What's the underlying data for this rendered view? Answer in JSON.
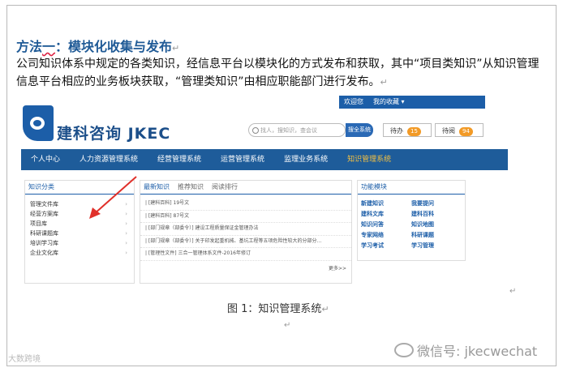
{
  "doc": {
    "heading_prefix": "方法",
    "heading_underlined": "一",
    "heading_rest": "：模块化收集与发布",
    "paragraph": "公司知识体系中规定的各类知识，经信息平台以模块化的方式发布和获取，其中“项目类知识”从知识管理信息平台相应的业务板块获取，“管理类知识”由相应职能部门进行发布。",
    "mark": "↵",
    "caption": "图 1：知识管理系统"
  },
  "screenshot": {
    "logo_text": "建科咨询 JKEC",
    "welcome": [
      "欢迎您",
      "",
      "我的收藏 ▾"
    ],
    "search_placeholder": "找人，搜知识，查会议",
    "search_button": "搜全系统",
    "todo": {
      "label": "待办",
      "count": "15"
    },
    "pending": {
      "label": "待阅",
      "count": "94"
    },
    "nav": [
      "个人中心",
      "人力资源管理系统",
      "经营管理系统",
      "运营管理系统",
      "监理业务系统",
      "知识管理系统"
    ],
    "nav_active_index": 5,
    "category_title": "知识分类",
    "categories": [
      "管理文件库",
      "经营方案库",
      "项目库",
      "科研课题库",
      "培训学习库",
      "企业文化库"
    ],
    "news_tabs": [
      "最新知识",
      "推荐知识",
      "阅读排行"
    ],
    "news": [
      "| [建科百科] 19号文",
      "| [建科百科] 87号文",
      "| [部门规章（部委令）] 建设工程质量保证金管理办法",
      "| [部门规章（部委令）] 关于印发起重机械、基坑工程等五项危险性较大的分部分...",
      "| [管理性文件] 三合一管理体系文件-2016年修订"
    ],
    "more": "更多>>",
    "func_title": "功能模块",
    "functions": [
      "新建知识",
      "我要提问",
      "建科文库",
      "建科百科",
      "知识问答",
      "知识地图",
      "专家网络",
      "科研课题",
      "学习考试",
      "学习管理"
    ]
  },
  "watermarks": {
    "left": "大数跨境",
    "right": "微信号: jkecwechat"
  },
  "colors": {
    "heading": "#1f5a96",
    "nav_bg": "#1e5c9a",
    "nav_active": "#f3c043",
    "badge": "#f29a26",
    "arrow": "#e0302a"
  }
}
